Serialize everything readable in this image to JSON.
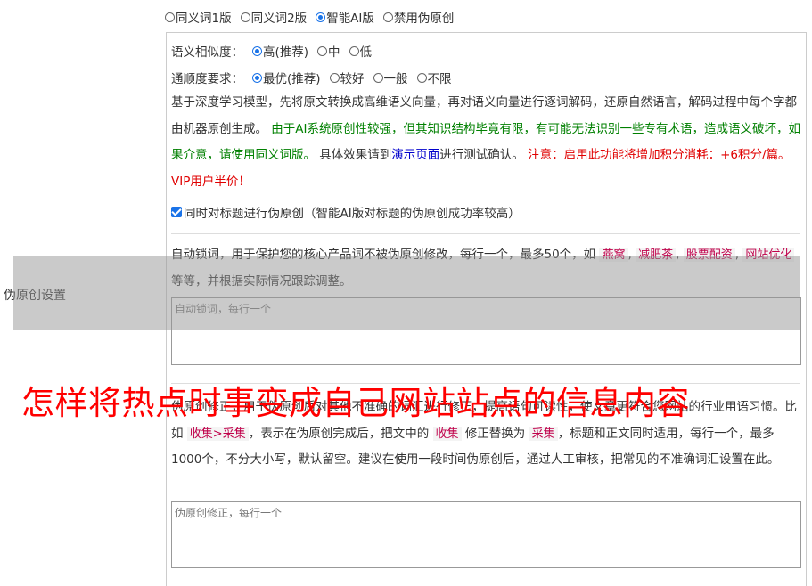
{
  "section_label": "伪原创设置",
  "mode_options": [
    {
      "label": "同义词1版",
      "selected": false
    },
    {
      "label": "同义词2版",
      "selected": false
    },
    {
      "label": "智能AI版",
      "selected": true
    },
    {
      "label": "禁用伪原创",
      "selected": false
    }
  ],
  "similarity": {
    "label": "语义相似度：",
    "options": [
      {
        "label": "高(推荐)",
        "selected": true
      },
      {
        "label": "中",
        "selected": false
      },
      {
        "label": "低",
        "selected": false
      }
    ]
  },
  "fluency": {
    "label": "通顺度要求：",
    "options": [
      {
        "label": "最优(推荐)",
        "selected": true
      },
      {
        "label": "较好",
        "selected": false
      },
      {
        "label": "一般",
        "selected": false
      },
      {
        "label": "不限",
        "selected": false
      }
    ]
  },
  "description": {
    "part1": "基于深度学习模型，先将原文转换成高维语义向量，再对语义向量进行逐词解码，还原自然语言，解码过程中每个字都由机器原创生成。",
    "part2_green": "由于AI系统原创性较强，但其知识结构毕竟有限，有可能无法识别一些专有术语，造成语义破坏，如果介意，请使用同义词版。",
    "part3": "具体效果请到",
    "link": "演示页面",
    "part4": "进行测试确认。",
    "part5_red": "注意：启用此功能将增加积分消耗：+6积分/篇。VIP用户半价！"
  },
  "title_checkbox": {
    "checked": true,
    "label": "同时对标题进行伪原创（智能AI版对标题的伪原创成功率较高）"
  },
  "lock_words": {
    "text_before": "自动锁词，用于保护您的核心产品词不被伪原创修改，每行一个，最多50个，如",
    "examples": [
      "燕窝",
      "减肥茶",
      "股票配资",
      "网站优化"
    ],
    "text_after": "等等，并根据实际情况跟踪调整。",
    "placeholder": "自动锁词，每行一个"
  },
  "correction": {
    "text1": "伪原创修正，用于伪原创后对其他不准确的词汇进行修正，提高语句可读性，使文章更符合您网站的行业用语习惯。比如",
    "example_rule": "收集>采集",
    "text2": "，表示在伪原创完成后，把文中的",
    "example_from": "收集",
    "text3": "修正替换为",
    "example_to": "采集",
    "text4": "，标题和正文同时适用，每行一个，最多1000个，不分大小写，默认留空。建议在使用一段时间伪原创后，通过人工审核，把常见的不准确词汇设置在此。",
    "placeholder": "伪原创修正，每行一个"
  },
  "overlay_title": "怎样将热点时事变成自己网站站点的信息内容",
  "colors": {
    "accent": "#1a73e8",
    "green": "#008000",
    "red": "#e00000",
    "link": "#0000cc",
    "keyword": "#c0004a",
    "overlay": "#ff0000"
  }
}
